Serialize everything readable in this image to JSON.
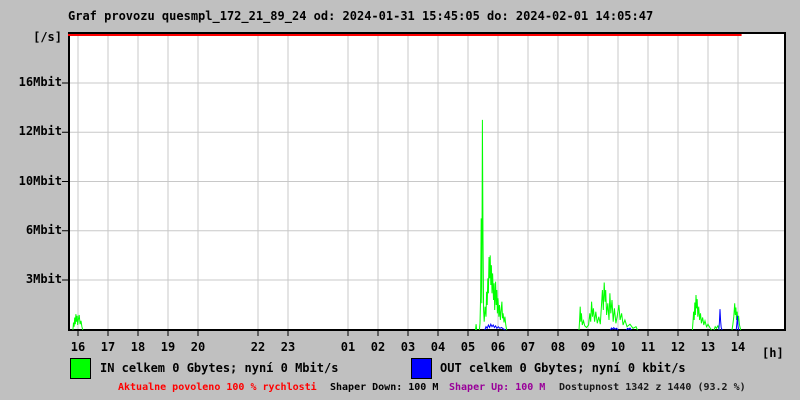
{
  "window": {
    "title": "Graf provozu quesmpl_172_21_89_24 od: 2024-01-31 15:45:05 do: 2024-02-01 14:05:47"
  },
  "colors": {
    "background": "#c0c0c0",
    "plot_background": "#ffffff",
    "grid": "#c8c8c8",
    "border": "#000000",
    "in_series": "#00ff00",
    "out_series": "#0000ff",
    "allowed_line": "#ff0000",
    "alert_text": "#ff0000",
    "shaper_up_text": "#990099"
  },
  "legend": {
    "in_label": "IN celkem 0 Gbytes; nyní 0 Mbit/s",
    "out_label": "OUT celkem 0 Gbytes; nyní 0 kbit/s"
  },
  "status": {
    "allowed": "Aktualne povoleno 100 % rychlosti",
    "shaper_down": "Shaper Down: 100 M",
    "shaper_up": "Shaper Up: 100 M",
    "availability": "Dostupnost 1342 z 1440 (93.2 %)"
  },
  "chart_data": {
    "type": "line",
    "title": "Graf provozu quesmpl_172_21_89_24 od: 2024-01-31 15:45:05 do: 2024-02-01 14:05:47",
    "y_unit_label": "[/s]",
    "x_unit_label": "[h]",
    "grid": true,
    "y_ticks": [
      {
        "label": "16Mbit",
        "value": 16
      },
      {
        "label": "12Mbit",
        "value": 12
      },
      {
        "label": "10Mbit",
        "value": 10
      },
      {
        "label": "6Mbit",
        "value": 6
      },
      {
        "label": "3Mbit",
        "value": 3
      }
    ],
    "x_ticks": [
      {
        "label": "16",
        "t": 16
      },
      {
        "label": "17",
        "t": 17
      },
      {
        "label": "18",
        "t": 18
      },
      {
        "label": "19",
        "t": 19
      },
      {
        "label": "20",
        "t": 20
      },
      {
        "label": "22",
        "t": 22
      },
      {
        "label": "23",
        "t": 23
      },
      {
        "label": "01",
        "t": 25
      },
      {
        "label": "02",
        "t": 26
      },
      {
        "label": "03",
        "t": 27
      },
      {
        "label": "04",
        "t": 28
      },
      {
        "label": "05",
        "t": 29
      },
      {
        "label": "06",
        "t": 30
      },
      {
        "label": "07",
        "t": 31
      },
      {
        "label": "08",
        "t": 32
      },
      {
        "label": "09",
        "t": 33
      },
      {
        "label": "10",
        "t": 34
      },
      {
        "label": "11",
        "t": 35
      },
      {
        "label": "12",
        "t": 36
      },
      {
        "label": "13",
        "t": 37
      },
      {
        "label": "14",
        "t": 38
      }
    ],
    "allowed_speed_line": {
      "percent": 100,
      "t_start": 15.67,
      "t_end": 38.12
    },
    "series": [
      {
        "name": "IN",
        "color": "#00ff00",
        "unit": "Mbit/s",
        "clusters": [
          [
            [
              15.83,
              0
            ],
            [
              15.85,
              0.45
            ],
            [
              15.87,
              0.2
            ],
            [
              15.89,
              0.75
            ],
            [
              15.91,
              0.35
            ],
            [
              15.93,
              0.95
            ],
            [
              15.95,
              0.5
            ],
            [
              15.97,
              0.85
            ],
            [
              15.99,
              0.3
            ],
            [
              16.01,
              0.6
            ],
            [
              16.04,
              0.9
            ],
            [
              16.07,
              0.35
            ],
            [
              16.1,
              0.55
            ],
            [
              16.13,
              0.2
            ],
            [
              16.16,
              0
            ]
          ],
          [
            [
              29.25,
              0
            ],
            [
              29.27,
              0.35
            ],
            [
              29.29,
              0
            ]
          ],
          [
            [
              29.38,
              0
            ],
            [
              29.4,
              0.4
            ],
            [
              29.42,
              2.0
            ],
            [
              29.44,
              7.0
            ],
            [
              29.46,
              1.6
            ],
            [
              29.48,
              13.0
            ],
            [
              29.5,
              5.5
            ],
            [
              29.52,
              1.2
            ],
            [
              29.54,
              0.5
            ],
            [
              29.57,
              1.4
            ],
            [
              29.6,
              0.8
            ],
            [
              29.62,
              2.3
            ],
            [
              29.64,
              1.5
            ],
            [
              29.66,
              3.1
            ],
            [
              29.68,
              2.2
            ],
            [
              29.7,
              4.4
            ],
            [
              29.72,
              3.1
            ],
            [
              29.74,
              4.5
            ],
            [
              29.76,
              2.7
            ],
            [
              29.78,
              3.9
            ],
            [
              29.8,
              2.2
            ],
            [
              29.82,
              3.4
            ],
            [
              29.85,
              1.8
            ],
            [
              29.87,
              2.8
            ],
            [
              29.89,
              1.2
            ],
            [
              29.92,
              2.9
            ],
            [
              29.94,
              1.5
            ],
            [
              29.96,
              2.4
            ],
            [
              29.98,
              1.0
            ],
            [
              30.0,
              1.9
            ],
            [
              30.03,
              0.8
            ],
            [
              30.05,
              1.5
            ],
            [
              30.08,
              0.6
            ],
            [
              30.1,
              1.1
            ],
            [
              30.13,
              1.7
            ],
            [
              30.15,
              0.7
            ],
            [
              30.17,
              1.0
            ],
            [
              30.2,
              0.45
            ],
            [
              30.23,
              0.8
            ],
            [
              30.26,
              0.3
            ],
            [
              30.29,
              0
            ]
          ],
          [
            [
              32.7,
              0
            ],
            [
              32.72,
              0.6
            ],
            [
              32.74,
              1.4
            ],
            [
              32.76,
              0.5
            ],
            [
              32.78,
              1.0
            ],
            [
              32.81,
              0.3
            ],
            [
              32.85,
              0.55
            ],
            [
              32.89,
              0.25
            ],
            [
              32.95,
              0.15
            ],
            [
              33.02,
              0.3
            ],
            [
              33.06,
              1.0
            ],
            [
              33.09,
              0.5
            ],
            [
              33.12,
              1.7
            ],
            [
              33.15,
              0.8
            ],
            [
              33.18,
              1.3
            ],
            [
              33.22,
              0.5
            ],
            [
              33.26,
              1.1
            ],
            [
              33.31,
              0.4
            ],
            [
              33.36,
              0.8
            ],
            [
              33.41,
              0.35
            ],
            [
              33.45,
              1.5
            ],
            [
              33.48,
              2.4
            ],
            [
              33.51,
              1.2
            ],
            [
              33.54,
              2.85
            ],
            [
              33.57,
              1.7
            ],
            [
              33.59,
              2.4
            ],
            [
              33.62,
              0.9
            ],
            [
              33.66,
              1.6
            ],
            [
              33.7,
              0.6
            ],
            [
              33.73,
              2.2
            ],
            [
              33.76,
              1.0
            ],
            [
              33.8,
              1.8
            ],
            [
              33.84,
              0.5
            ],
            [
              33.88,
              1.3
            ],
            [
              33.93,
              0.4
            ],
            [
              33.98,
              0.9
            ],
            [
              34.03,
              1.5
            ],
            [
              34.07,
              0.6
            ],
            [
              34.12,
              1.0
            ],
            [
              34.17,
              0.3
            ],
            [
              34.23,
              0.6
            ],
            [
              34.3,
              0.2
            ],
            [
              34.4,
              0.35
            ],
            [
              34.5,
              0.1
            ],
            [
              34.6,
              0.2
            ],
            [
              34.65,
              0
            ]
          ],
          [
            [
              36.48,
              0
            ],
            [
              36.5,
              0.5
            ],
            [
              36.52,
              1.1
            ],
            [
              36.54,
              0.6
            ],
            [
              36.56,
              1.65
            ],
            [
              36.58,
              0.9
            ],
            [
              36.6,
              2.1
            ],
            [
              36.62,
              1.3
            ],
            [
              36.64,
              1.85
            ],
            [
              36.66,
              0.8
            ],
            [
              36.69,
              1.4
            ],
            [
              36.72,
              0.6
            ],
            [
              36.75,
              1.0
            ],
            [
              36.78,
              0.4
            ],
            [
              36.82,
              0.75
            ],
            [
              36.86,
              0.3
            ],
            [
              36.9,
              0.55
            ],
            [
              36.95,
              0.2
            ],
            [
              37.0,
              0.35
            ],
            [
              37.06,
              0.15
            ],
            [
              37.12,
              0
            ]
          ],
          [
            [
              37.2,
              0
            ],
            [
              37.24,
              0.2
            ],
            [
              37.28,
              0.1
            ],
            [
              37.33,
              0.25
            ],
            [
              37.38,
              0
            ]
          ],
          [
            [
              37.8,
              0
            ],
            [
              37.83,
              0.35
            ],
            [
              37.86,
              0.8
            ],
            [
              37.89,
              1.6
            ],
            [
              37.91,
              0.9
            ],
            [
              37.93,
              1.35
            ],
            [
              37.95,
              0.6
            ],
            [
              37.97,
              1.1
            ],
            [
              37.99,
              0.5
            ],
            [
              38.02,
              0.85
            ],
            [
              38.05,
              0.3
            ],
            [
              38.09,
              0
            ]
          ]
        ]
      },
      {
        "name": "OUT",
        "color": "#0000ff",
        "unit": "kbit/s",
        "clusters": [
          [
            [
              29.56,
              0
            ],
            [
              29.6,
              0.2
            ],
            [
              29.64,
              0.1
            ],
            [
              29.68,
              0.3
            ],
            [
              29.72,
              0.15
            ],
            [
              29.76,
              0.35
            ],
            [
              29.8,
              0.2
            ],
            [
              29.84,
              0.3
            ],
            [
              29.88,
              0.15
            ],
            [
              29.92,
              0.25
            ],
            [
              29.96,
              0.1
            ],
            [
              30.01,
              0.2
            ],
            [
              30.06,
              0.1
            ],
            [
              30.12,
              0.15
            ],
            [
              30.18,
              0.06
            ],
            [
              30.25,
              0
            ]
          ],
          [
            [
              33.75,
              0
            ],
            [
              33.78,
              0.12
            ],
            [
              33.82,
              0.06
            ],
            [
              33.86,
              0.14
            ],
            [
              33.9,
              0.05
            ],
            [
              33.95,
              0.1
            ],
            [
              34.0,
              0
            ]
          ],
          [
            [
              34.28,
              0
            ],
            [
              34.32,
              0.1
            ],
            [
              34.36,
              0.05
            ],
            [
              34.4,
              0.12
            ],
            [
              34.44,
              0
            ]
          ],
          [
            [
              37.36,
              0
            ],
            [
              37.38,
              0.45
            ],
            [
              37.4,
              1.25
            ],
            [
              37.42,
              0.55
            ],
            [
              37.44,
              0.15
            ],
            [
              37.47,
              0
            ]
          ],
          [
            [
              37.94,
              0
            ],
            [
              37.96,
              0.35
            ],
            [
              37.98,
              0.85
            ],
            [
              38.0,
              0.25
            ],
            [
              38.02,
              0
            ]
          ]
        ]
      }
    ]
  }
}
